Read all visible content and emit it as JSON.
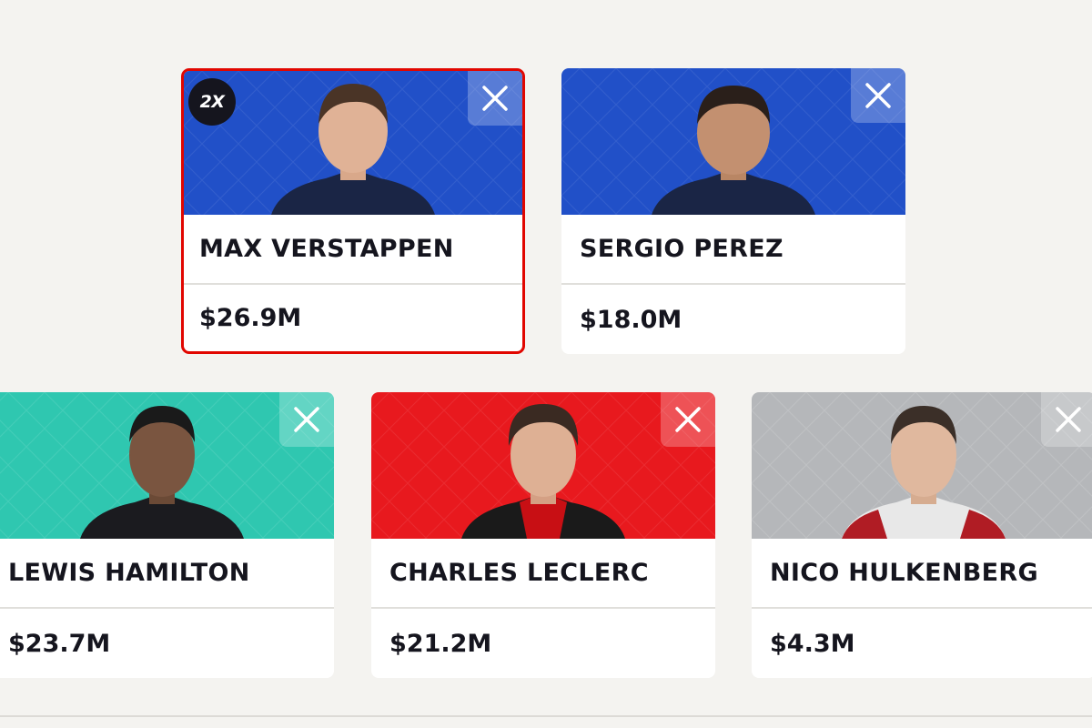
{
  "drivers": [
    {
      "name": "MAX VERSTAPPEN",
      "price": "$26.9M",
      "badge": "2X",
      "team_color": "#2150c8",
      "suit_color": "#1a2545",
      "selected": true
    },
    {
      "name": "SERGIO PEREZ",
      "price": "$18.0M",
      "team_color": "#2150c8",
      "suit_color": "#1a2545"
    },
    {
      "name": "LEWIS HAMILTON",
      "price": "$23.7M",
      "team_color": "#2fc7b0",
      "suit_color": "#1b1b1f"
    },
    {
      "name": "CHARLES LECLERC",
      "price": "$21.2M",
      "team_color": "#e8191e",
      "suit_color": "#c80f14"
    },
    {
      "name": "NICO HULKENBERG",
      "price": "$4.3M",
      "team_color": "#b5b7ba",
      "suit_color": "#e8e8e8"
    }
  ],
  "accent_color": "#e10600",
  "icons": {
    "remove": "close-icon",
    "badge": "2x-boost-badge"
  }
}
